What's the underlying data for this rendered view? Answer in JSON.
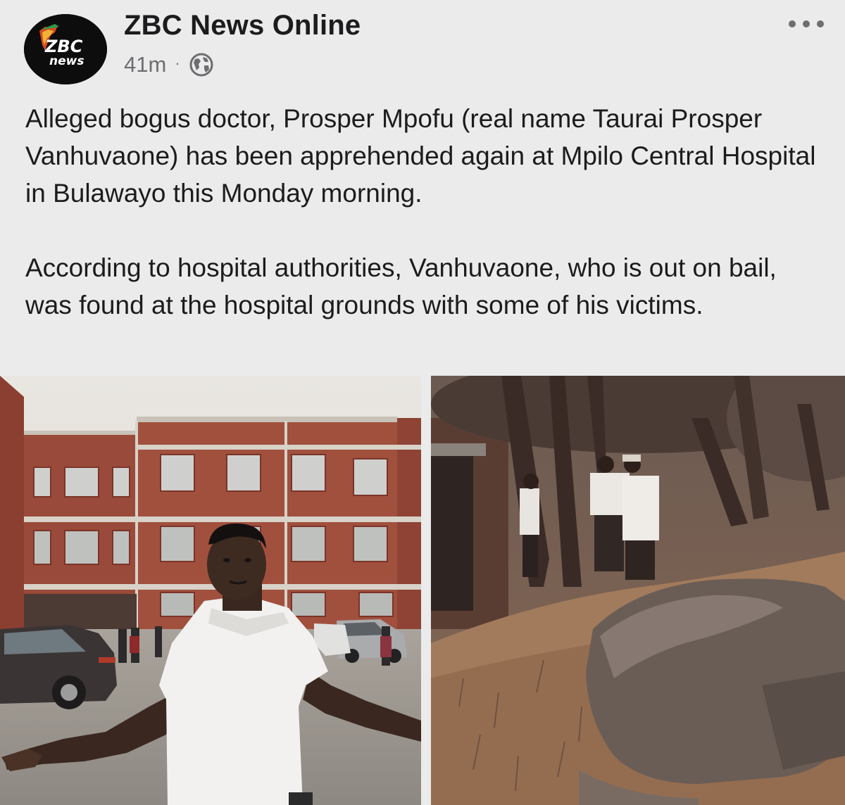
{
  "post": {
    "page_name": "ZBC News Online",
    "timestamp": "41m",
    "separator": "·",
    "privacy_icon": "globe-icon",
    "more_icon": "more-horizontal-icon",
    "avatar": {
      "logo_text_top": "ZBC",
      "logo_text_bottom": "news"
    },
    "paragraphs": [
      "Alleged bogus doctor, Prosper Mpofu (real name Taurai Prosper Vanhuvaone) has been apprehended again at Mpilo Central Hospital in Bulawayo this Monday morning.",
      "According to hospital authorities, Vanhuvaone, who is out on bail, was found at the hospital grounds with some of his victims."
    ],
    "photos": [
      {
        "description_icon": "photo-man-in-front-of-hospital"
      },
      {
        "description_icon": "photo-men-among-trees"
      }
    ]
  },
  "colors": {
    "background": "#ebebeb",
    "text_primary": "#1c1c1e",
    "text_secondary": "#6d6d72",
    "avatar_bg": "#0d0d0d",
    "brick": "#9a4a3a"
  }
}
